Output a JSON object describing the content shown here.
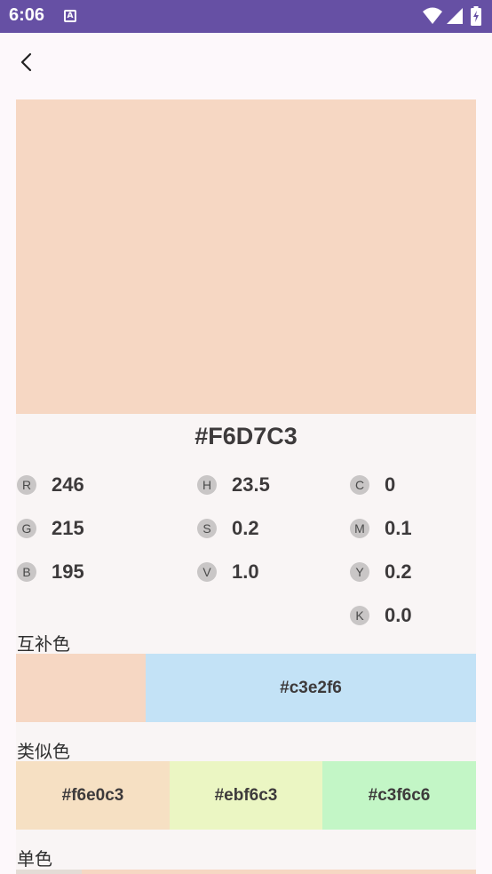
{
  "status_bar": {
    "time": "6:06",
    "notification_icon_letter": "A"
  },
  "color": {
    "hex": "#F6D7C3",
    "swatch": "#F6D7C3",
    "rgb": [
      {
        "label": "R",
        "value": "246"
      },
      {
        "label": "G",
        "value": "215"
      },
      {
        "label": "B",
        "value": "195"
      }
    ],
    "hsv": [
      {
        "label": "H",
        "value": "23.5"
      },
      {
        "label": "S",
        "value": "0.2"
      },
      {
        "label": "V",
        "value": "1.0"
      }
    ],
    "cmyk": [
      {
        "label": "C",
        "value": "0"
      },
      {
        "label": "M",
        "value": "0.1"
      },
      {
        "label": "Y",
        "value": "0.2"
      },
      {
        "label": "K",
        "value": "0.0"
      }
    ]
  },
  "complementary": {
    "label": "互补色",
    "base_color": "#F6D7C3",
    "comp_color": "#C3E2F6",
    "comp_hex": "#c3e2f6"
  },
  "analogous": {
    "label": "类似色",
    "items": [
      {
        "hex": "#f6e0c3",
        "color": "#F6E0C3"
      },
      {
        "hex": "#ebf6c3",
        "color": "#EBF6C3"
      },
      {
        "hex": "#c3f6c6",
        "color": "#C3F6C6"
      }
    ]
  },
  "monochrome": {
    "label": "单色"
  }
}
